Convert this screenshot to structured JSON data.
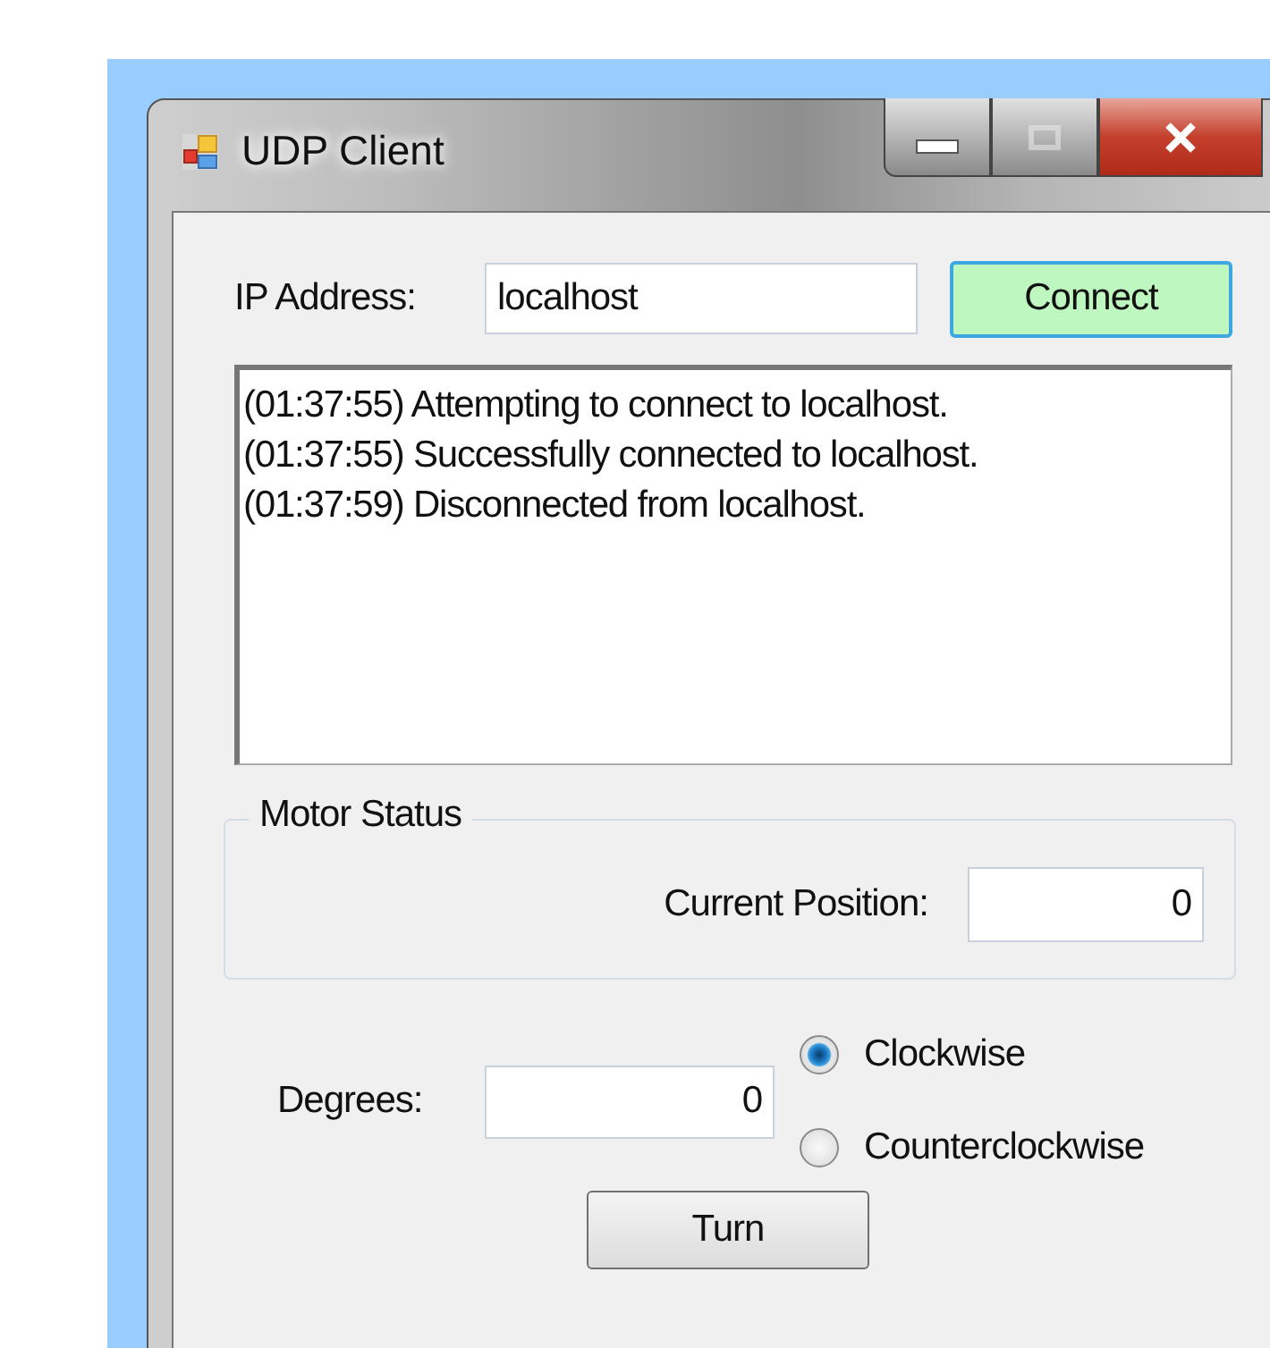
{
  "window": {
    "title": "UDP Client"
  },
  "ip_address": {
    "label": "IP Address:",
    "value": "localhost"
  },
  "connect_button": {
    "label": "Connect"
  },
  "log": [
    "(01:37:55) Attempting to connect to localhost.",
    "(01:37:55) Successfully connected to localhost.",
    "(01:37:59) Disconnected from localhost."
  ],
  "motor_status": {
    "title": "Motor Status",
    "current_position": {
      "label": "Current Position:",
      "value": "0"
    }
  },
  "degrees": {
    "label": "Degrees:",
    "value": "0"
  },
  "direction": [
    {
      "label": "Clockwise",
      "selected": true
    },
    {
      "label": "Counterclockwise",
      "selected": false
    }
  ],
  "turn_button": {
    "label": "Turn"
  }
}
